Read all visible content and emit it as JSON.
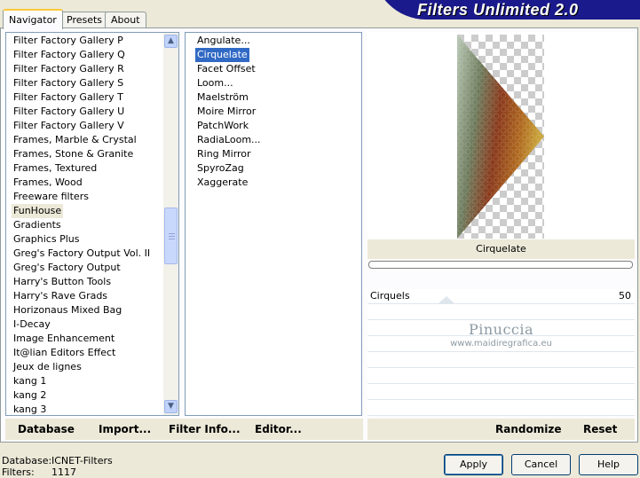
{
  "tabs": [
    {
      "label": "Navigator",
      "active": true
    },
    {
      "label": "Presets",
      "active": false
    },
    {
      "label": "About",
      "active": false
    }
  ],
  "app_title": "Filters Unlimited 2.0",
  "categories": [
    "Filter Factory Gallery P",
    "Filter Factory Gallery Q",
    "Filter Factory Gallery R",
    "Filter Factory Gallery S",
    "Filter Factory Gallery T",
    "Filter Factory Gallery U",
    "Filter Factory Gallery V",
    "Frames, Marble & Crystal",
    "Frames, Stone & Granite",
    "Frames, Textured",
    "Frames, Wood",
    "Freeware filters",
    "FunHouse",
    "Gradients",
    "Graphics Plus",
    "Greg's Factory Output Vol. II",
    "Greg's Factory Output",
    "Harry's Button Tools",
    "Harry's Rave Grads",
    "Horizonaus Mixed Bag",
    "I-Decay",
    "Image Enhancement",
    "It@lian Editors Effect",
    "Jeux de lignes",
    "kang 1",
    "kang 2",
    "kang 3"
  ],
  "selected_category": "FunHouse",
  "filters": [
    "Angulate...",
    "Cirquelate",
    "Facet Offset",
    "Loom...",
    "Maelström",
    "Moire Mirror",
    "PatchWork",
    "RadiaLoom...",
    "Ring Mirror",
    "SpyroZag",
    "Xaggerate"
  ],
  "selected_filter": "Cirquelate",
  "preview_filter_name": "Cirquelate",
  "sliders": [
    {
      "label": "Cirquels",
      "value": "50",
      "level": 50
    }
  ],
  "watermark": {
    "name": "Pinuccia",
    "url": "www.maidiregrafica.eu"
  },
  "left_commands": {
    "database": "Database",
    "import": "Import...",
    "filter_info": "Filter Info...",
    "editor": "Editor..."
  },
  "right_commands": {
    "randomize": "Randomize",
    "reset": "Reset"
  },
  "status": {
    "database_label": "Database:",
    "database_value": "ICNET-Filters",
    "filters_label": "Filters:",
    "filters_value": "1117"
  },
  "buttons": {
    "apply": "Apply",
    "cancel": "Cancel",
    "help": "Help"
  },
  "icons": {
    "scroll_up": "chevron-up-icon",
    "scroll_down": "chevron-down-icon"
  },
  "colors": {
    "banner": "#1a1a8c",
    "selection": "#316ac5",
    "tab_highlight": "#ffc83c"
  }
}
